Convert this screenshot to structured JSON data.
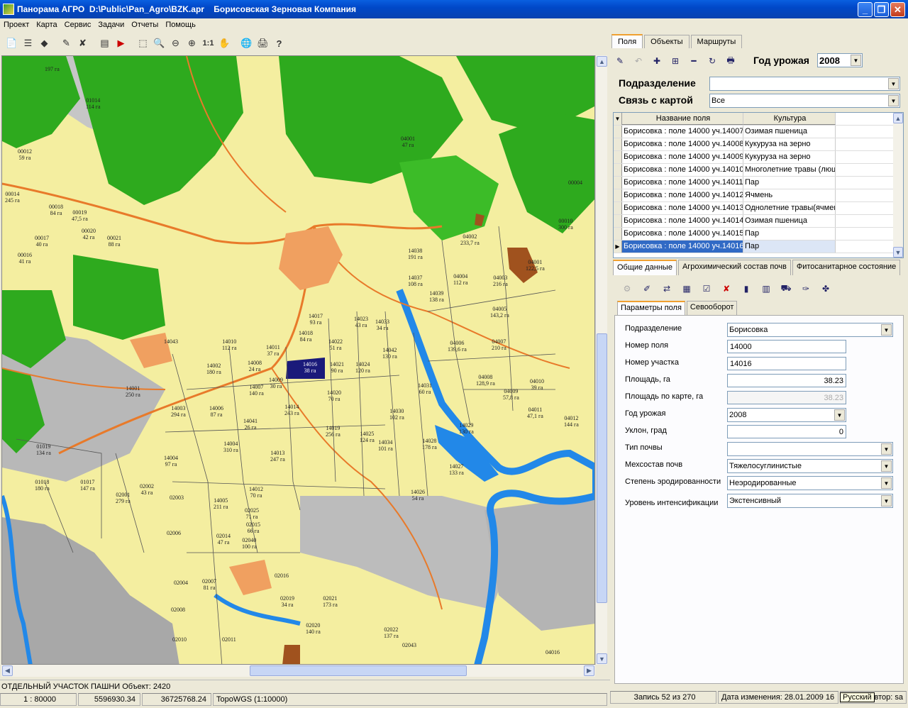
{
  "window": {
    "title": "Панорама АГРО  D:\\Public\\Pan_Agro\\BZK.apr    Борисовская Зерновая Компания"
  },
  "menu": [
    "Проект",
    "Карта",
    "Сервис",
    "Задачи",
    "Отчеты",
    "Помощь"
  ],
  "map": {
    "labels": [
      {
        "t": "01014\n114 га"
      },
      {
        "t": "00012\n59 га"
      },
      {
        "t": "00014\n245 га"
      },
      {
        "t": "00018\n84 га"
      },
      {
        "t": "00019\n47,5 га"
      },
      {
        "t": "00020\n42 га"
      },
      {
        "t": "00021\n88 га"
      },
      {
        "t": "00017\n40 га"
      },
      {
        "t": "00016\n41 га"
      },
      {
        "t": "04001\n47 га"
      },
      {
        "t": "04002\n233,7 га"
      },
      {
        "t": "04004\n112 га"
      },
      {
        "t": "04003\n216 га"
      },
      {
        "t": "14039\n138 га"
      },
      {
        "t": "14038\n191 га"
      },
      {
        "t": "14037\n108 га"
      },
      {
        "t": "04005\n143,2 га"
      },
      {
        "t": "04007\n210 га"
      },
      {
        "t": "04006\n139,6 га"
      },
      {
        "t": "04008\n128,9 га"
      },
      {
        "t": "04009\n57,8 га"
      },
      {
        "t": "04010\n39 га"
      },
      {
        "t": "04011\n47,1 га"
      },
      {
        "t": "04012\n144 га"
      },
      {
        "t": "04001\n122,5 га"
      },
      {
        "t": "00010\n300 га"
      },
      {
        "t": "00004\n"
      },
      {
        "t": "14017\n93 га"
      },
      {
        "t": "14023\n43 га"
      },
      {
        "t": "14033\n34 га"
      },
      {
        "t": "14018\n84 га"
      },
      {
        "t": "14022\n51 га"
      },
      {
        "t": "14042\n130 га"
      },
      {
        "t": "14010\n112 га"
      },
      {
        "t": "14011\n37 га"
      },
      {
        "t": "14016\n38 га"
      },
      {
        "t": "14021\n90 га"
      },
      {
        "t": "14024\n120 га"
      },
      {
        "t": "14002\n180 га"
      },
      {
        "t": "14008\n24 га"
      },
      {
        "t": "14009\n30 га"
      },
      {
        "t": "14001\n250 га"
      },
      {
        "t": "14007\n140 га"
      },
      {
        "t": "14020\n70 га"
      },
      {
        "t": "14031\n60 га"
      },
      {
        "t": "14003\n294 га"
      },
      {
        "t": "14006\n87 га"
      },
      {
        "t": "14014\n243 га"
      },
      {
        "t": "14030\n102 га"
      },
      {
        "t": "14029\n130 га"
      },
      {
        "t": "14041\n26 га"
      },
      {
        "t": "14019\n256 га"
      },
      {
        "t": "14025\n124 га"
      },
      {
        "t": "14034\n101 га"
      },
      {
        "t": "14028\n178 га"
      },
      {
        "t": "14004\n310 га"
      },
      {
        "t": "14013\n247 га"
      },
      {
        "t": "14027\n133 га"
      },
      {
        "t": "14004\n97 га"
      },
      {
        "t": "14026\n54 га"
      },
      {
        "t": "01019\n134 га"
      },
      {
        "t": "01018\n180 га"
      },
      {
        "t": "01017\n147 га"
      },
      {
        "t": "02001\n279 га"
      },
      {
        "t": "02002\n43 га"
      },
      {
        "t": "02003\n"
      },
      {
        "t": "14012\n70 га"
      },
      {
        "t": "14005\n211 га"
      },
      {
        "t": "02025\n71 га"
      },
      {
        "t": "02015\n66 га"
      },
      {
        "t": "02014\n47 га"
      },
      {
        "t": "02040\n100 га"
      },
      {
        "t": "02006\n"
      },
      {
        "t": "02004\n"
      },
      {
        "t": "02007\n81 га"
      },
      {
        "t": "02008\n"
      },
      {
        "t": "02010\n"
      },
      {
        "t": "02011\n"
      },
      {
        "t": "02016\n"
      },
      {
        "t": "02019\n34 га"
      },
      {
        "t": "02021\n173 га"
      },
      {
        "t": "02020\n140 га"
      },
      {
        "t": "02022\n137 га"
      },
      {
        "t": "02043\n"
      },
      {
        "t": "04016\n"
      },
      {
        "t": "197 га"
      },
      {
        "t": "14043\n"
      }
    ]
  },
  "status": {
    "object": "ОТДЕЛЬНЫЙ УЧАСТОК ПАШНИ Объект: 2420",
    "scale": "1 : 80000",
    "x": "5596930.34",
    "y": "36725768.24",
    "projection": "TopoWGS (1:10000)"
  },
  "right": {
    "tabs": [
      "Поля",
      "Объекты",
      "Маршруты"
    ],
    "harvest_label": "Год урожая",
    "harvest_year": "2008",
    "subdivision_label": "Подразделение",
    "subdivision_value": "",
    "map_link_label": "Связь с картой",
    "map_link_value": "Все",
    "grid_headers": [
      "Название поля",
      "Культура"
    ],
    "grid_rows": [
      {
        "name": "Борисовка : поле 14000 уч.14007",
        "crop": "Озимая пшеница"
      },
      {
        "name": "Борисовка : поле 14000 уч.14008",
        "crop": "Кукуруза на зерно"
      },
      {
        "name": "Борисовка : поле 14000 уч.14009",
        "crop": "Кукуруза на зерно"
      },
      {
        "name": "Борисовка : поле 14000 уч.14010",
        "crop": "Многолетние травы (люц"
      },
      {
        "name": "Борисовка : поле 14000 уч.14011",
        "crop": "Пар"
      },
      {
        "name": "Борисовка : поле 14000 уч.14012",
        "crop": "Ячмень"
      },
      {
        "name": "Борисовка : поле 14000 уч.14013",
        "crop": "Однолетние травы(ячмен"
      },
      {
        "name": "Борисовка : поле 14000 уч.14014",
        "crop": "Озимая пшеница"
      },
      {
        "name": "Борисовка : поле 14000 уч.14015",
        "crop": "Пар"
      },
      {
        "name": "Борисовка : поле 14000 уч.14016",
        "crop": "Пар"
      }
    ],
    "subtabs": [
      "Общие данные",
      "Агрохимический состав почв",
      "Фитосанитарное состояние"
    ],
    "param_tabs": [
      "Параметры поля",
      "Севооборот"
    ],
    "params": [
      {
        "label": "Подразделение",
        "value": "Борисовка"
      },
      {
        "label": "Номер поля",
        "value": "14000"
      },
      {
        "label": "Номер участка",
        "value": "14016"
      },
      {
        "label": "Площадь, га",
        "value": "38.23"
      },
      {
        "label": "Площадь по карте, га",
        "value": "38.23"
      },
      {
        "label": "Год урожая",
        "value": "2008"
      },
      {
        "label": "Уклон, град",
        "value": "0"
      },
      {
        "label": "Тип почвы",
        "value": ""
      },
      {
        "label": "Мехсостав почв",
        "value": "Тяжелосуглинистые"
      },
      {
        "label": "Степень эродированности",
        "value": "Неэродированные"
      },
      {
        "label": "Уровень интенсификации",
        "value": "Экстенсивный"
      }
    ],
    "record": "Запись 52 из 270",
    "changed": "Дата изменения: 28.01.2009 16",
    "author": "втор: sa",
    "lang": "Русский"
  },
  "colors": {
    "field": "#f4eea0",
    "forest": "#2eaa1e",
    "water": "#2288e8",
    "road": "#e87a2a",
    "selected_field": "#1a1a7a"
  }
}
